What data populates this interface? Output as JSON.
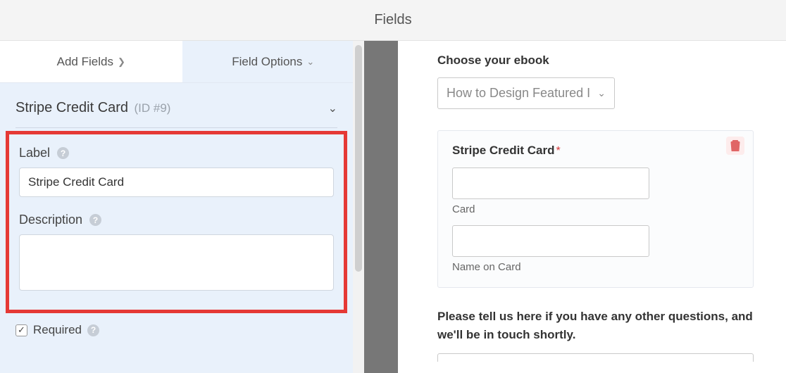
{
  "header": {
    "title": "Fields"
  },
  "tabs": {
    "add": "Add Fields",
    "options": "Field Options"
  },
  "field": {
    "name": "Stripe Credit Card",
    "id_label": "(ID #9)"
  },
  "options": {
    "label_caption": "Label",
    "label_value": "Stripe Credit Card",
    "description_caption": "Description",
    "description_value": "",
    "required_caption": "Required"
  },
  "preview": {
    "ebook_label": "Choose your ebook",
    "ebook_selected": "How to Design Featured I",
    "card_title": "Stripe Credit Card",
    "card_sublabel": "Card",
    "name_sublabel": "Name on Card",
    "question": "Please tell us here if you have any other questions, and we'll be in touch shortly."
  }
}
